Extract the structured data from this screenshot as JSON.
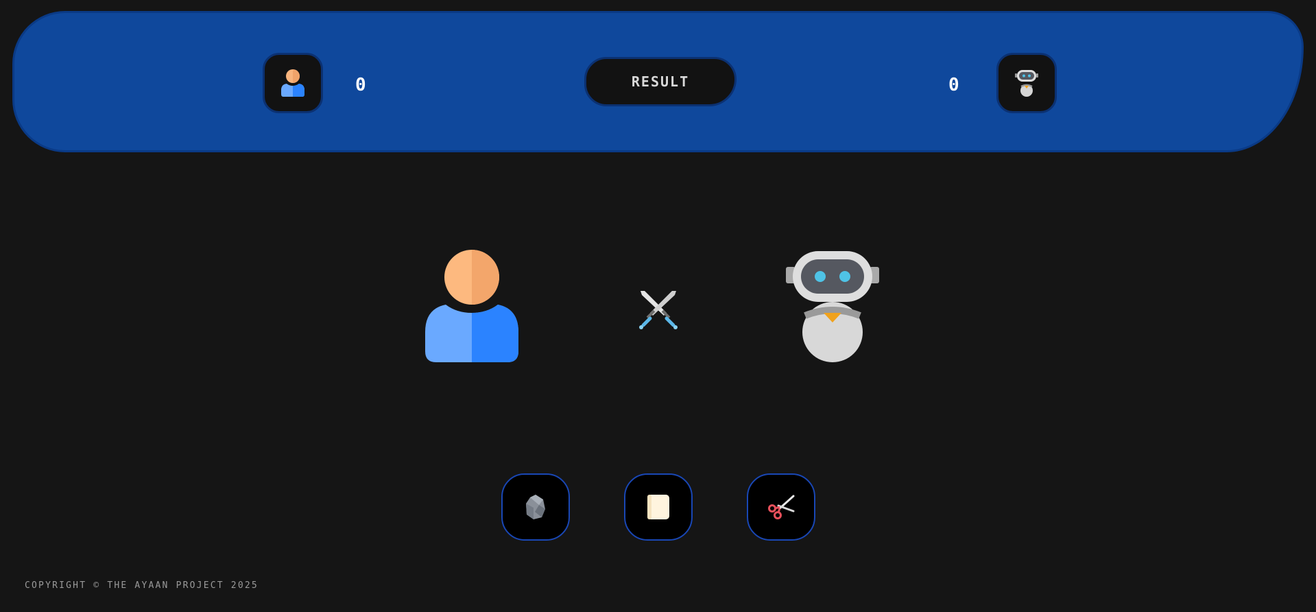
{
  "scoreboard": {
    "player_score": "0",
    "bot_score": "0",
    "result_label": "RESULT"
  },
  "icons": {
    "player": "person-icon",
    "bot": "robot-icon",
    "versus": "crossed-swords-icon",
    "rock": "rock-icon",
    "paper": "paper-icon",
    "scissors": "scissors-icon"
  },
  "colors": {
    "background": "#151515",
    "bar": "#0f489c",
    "button_border": "#1947b5"
  },
  "footer": {
    "copyright": "COPYRIGHT © THE AYAAN PROJECT 2025"
  }
}
